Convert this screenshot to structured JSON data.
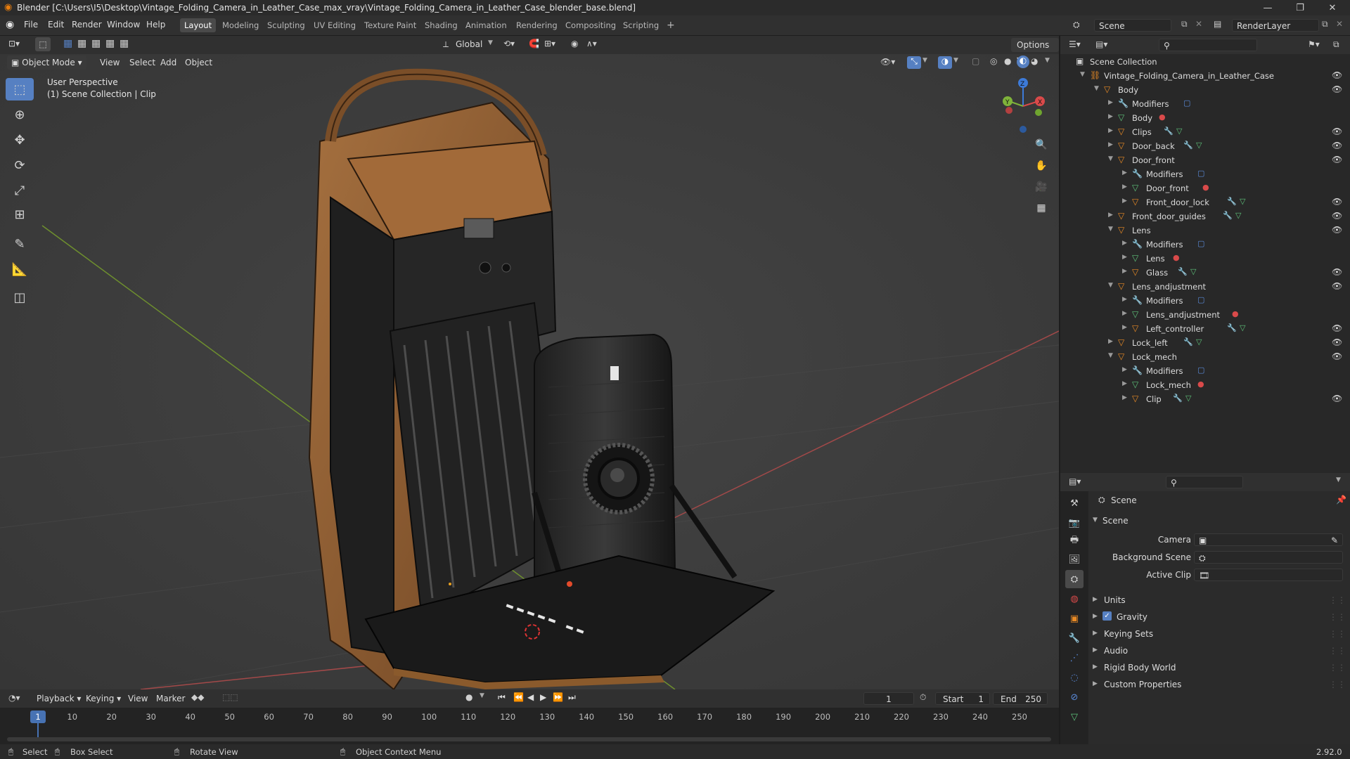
{
  "window": {
    "title": "Blender [C:\\Users\\I5\\Desktop\\Vintage_Folding_Camera_in_Leather_Case_max_vray\\Vintage_Folding_Camera_in_Leather_Case_blender_base.blend]"
  },
  "menu": [
    "File",
    "Edit",
    "Render",
    "Window",
    "Help"
  ],
  "workspaces": [
    "Layout",
    "Modeling",
    "Sculpting",
    "UV Editing",
    "Texture Paint",
    "Shading",
    "Animation",
    "Rendering",
    "Compositing",
    "Scripting"
  ],
  "active_workspace": "Layout",
  "scene_selector": {
    "value": "Scene"
  },
  "renderlayer_selector": {
    "value": "RenderLayer"
  },
  "tool_header": {
    "orientation": "Global",
    "options_label": "Options"
  },
  "viewport": {
    "mode": "Object Mode",
    "menus": [
      "View",
      "Select",
      "Add",
      "Object"
    ],
    "overlay_line1": "User Perspective",
    "overlay_line2": "(1) Scene Collection | Clip",
    "gizmo": {
      "z": "Z",
      "y": "Y",
      "x": "X"
    }
  },
  "outliner": {
    "root": "Scene Collection",
    "items": [
      {
        "label": "Vintage_Folding_Camera_in_Leather_Case",
        "icon": "armature-icon",
        "depth": 0
      },
      {
        "label": "Body",
        "icon": "object-icon",
        "depth": 1
      },
      {
        "label": "Modifiers",
        "icon": "wrench-icon",
        "depth": 2
      },
      {
        "label": "Body",
        "icon": "mesh-icon",
        "depth": 2
      },
      {
        "label": "Clips",
        "icon": "object-icon",
        "depth": 2
      },
      {
        "label": "Door_back",
        "icon": "object-icon",
        "depth": 2
      },
      {
        "label": "Door_front",
        "icon": "object-icon",
        "depth": 2
      },
      {
        "label": "Modifiers",
        "icon": "wrench-icon",
        "depth": 3
      },
      {
        "label": "Door_front",
        "icon": "mesh-icon",
        "depth": 3
      },
      {
        "label": "Front_door_lock",
        "icon": "object-icon",
        "depth": 3
      },
      {
        "label": "Front_door_guides",
        "icon": "object-icon",
        "depth": 2
      },
      {
        "label": "Lens",
        "icon": "object-icon",
        "depth": 2
      },
      {
        "label": "Modifiers",
        "icon": "wrench-icon",
        "depth": 3
      },
      {
        "label": "Lens",
        "icon": "mesh-icon",
        "depth": 3
      },
      {
        "label": "Glass",
        "icon": "object-icon",
        "depth": 3
      },
      {
        "label": "Lens_andjustment",
        "icon": "object-icon",
        "depth": 2
      },
      {
        "label": "Modifiers",
        "icon": "wrench-icon",
        "depth": 3
      },
      {
        "label": "Lens_andjustment",
        "icon": "mesh-icon",
        "depth": 3
      },
      {
        "label": "Left_controller",
        "icon": "object-icon",
        "depth": 3
      },
      {
        "label": "Lock_left",
        "icon": "object-icon",
        "depth": 2
      },
      {
        "label": "Lock_mech",
        "icon": "object-icon",
        "depth": 2
      },
      {
        "label": "Modifiers",
        "icon": "wrench-icon",
        "depth": 3
      },
      {
        "label": "Lock_mech",
        "icon": "mesh-icon",
        "depth": 3
      },
      {
        "label": "Clip",
        "icon": "object-icon",
        "depth": 3
      }
    ]
  },
  "properties": {
    "header": "Scene",
    "panel": "Scene",
    "fields": [
      {
        "label": "Camera",
        "value": ""
      },
      {
        "label": "Background Scene",
        "value": ""
      },
      {
        "label": "Active Clip",
        "value": ""
      }
    ],
    "subpanels": [
      "Units",
      "Gravity",
      "Keying Sets",
      "Audio",
      "Rigid Body World",
      "Custom Properties"
    ]
  },
  "timeline": {
    "menus": [
      "Playback",
      "Keying",
      "View",
      "Marker"
    ],
    "current_frame": "1",
    "start_label": "Start",
    "start": "1",
    "end_label": "End",
    "end": "250",
    "ticks": [
      "1",
      "10",
      "20",
      "30",
      "40",
      "50",
      "60",
      "70",
      "80",
      "90",
      "100",
      "110",
      "120",
      "130",
      "140",
      "150",
      "160",
      "170",
      "180",
      "190",
      "200",
      "210",
      "220",
      "230",
      "240",
      "250"
    ]
  },
  "statusbar": {
    "select": "Select",
    "box_select": "Box Select",
    "rotate_view": "Rotate View",
    "context_menu": "Object Context Menu",
    "version": "2.92.0"
  }
}
